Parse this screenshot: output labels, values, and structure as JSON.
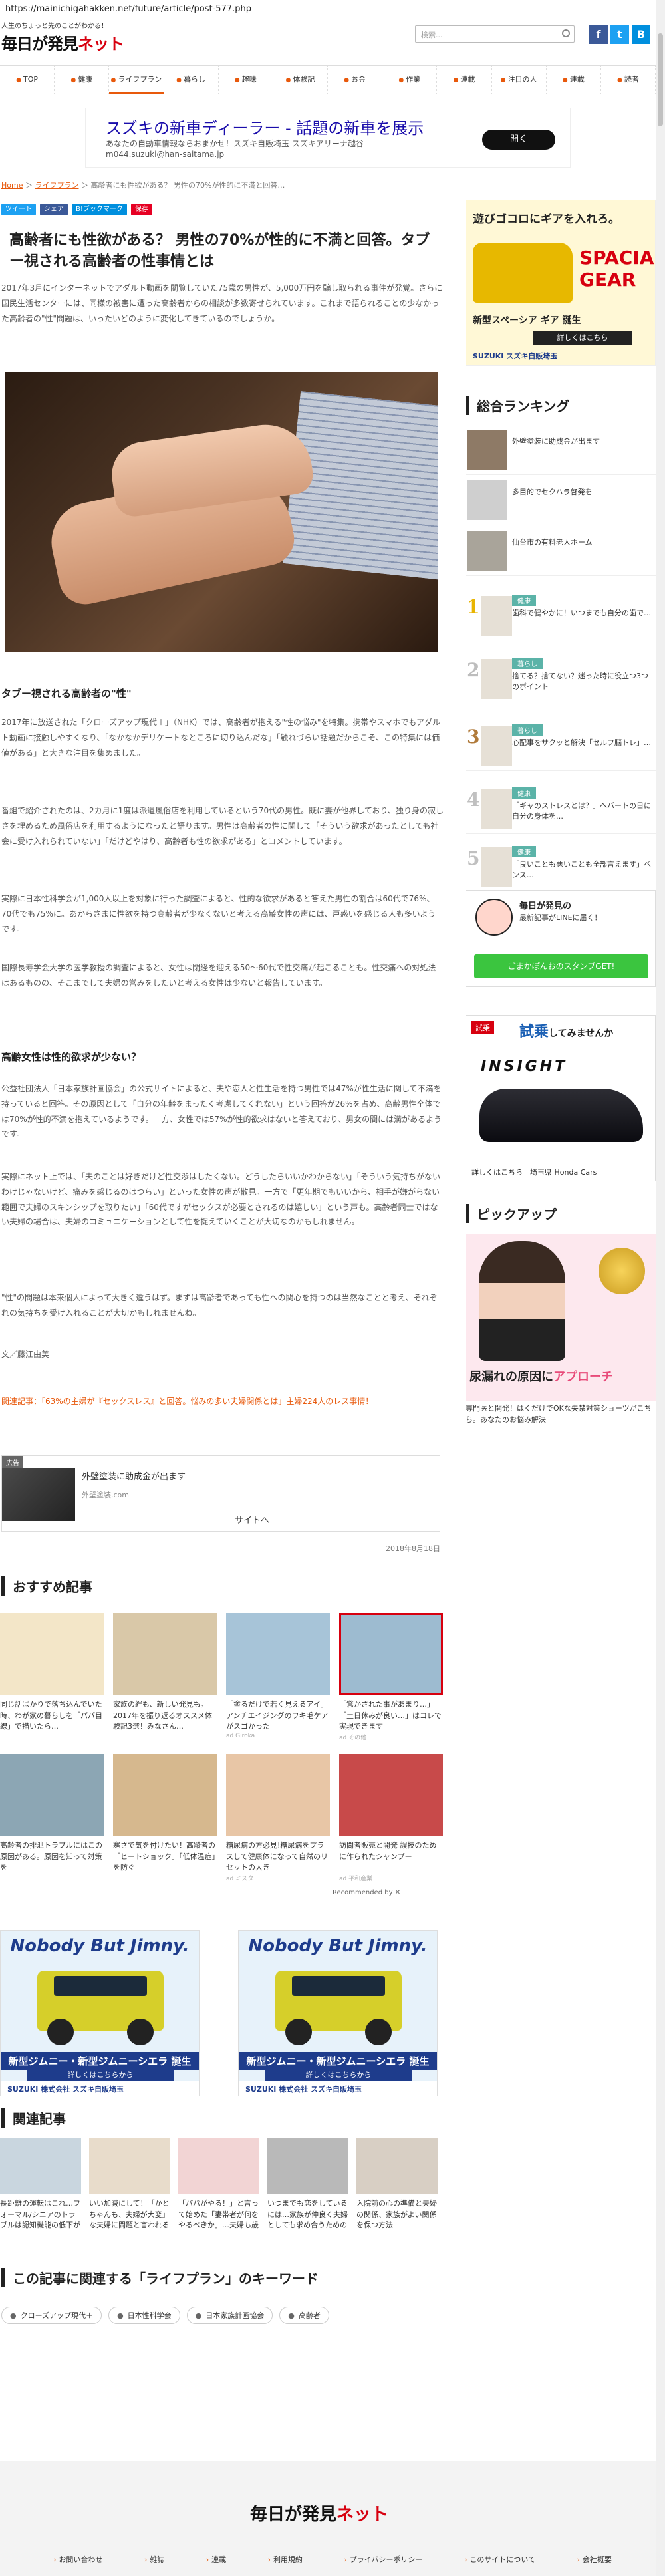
{
  "url": "https://mainichigahakken.net/future/article/post-577.php",
  "header": {
    "tagline": "人生のちょっと先のことがわかる！",
    "logo_main": "毎日が発見",
    "logo_net": "ネット",
    "search_placeholder": "検索...",
    "social": [
      "f",
      "t",
      "B"
    ]
  },
  "nav": [
    "TOP",
    "健康",
    "ライフプラン",
    "暮らし",
    "趣味",
    "体験記",
    "お金",
    "作業",
    "連載",
    "注目の人",
    "連載",
    "読者"
  ],
  "nav_active_index": 2,
  "ad_top": {
    "title": "スズキの新車ディーラー - 話題の新車を展示",
    "desc1": "あなたの自動車情報ならおまかせ！スズキ自販埼玉 スズキアリーナ越谷",
    "desc2": "m044.suzuki@han-saitama.jp",
    "button": "開く"
  },
  "breadcrumb": {
    "home": "Home",
    "sep1": "＞",
    "cat": "ライフプラン",
    "sep2": "＞",
    "current": "高齢者にも性欲がある？ 男性の70%が性的に不満と回答…"
  },
  "share": [
    {
      "label": "ツイート",
      "color": "#1da1f2"
    },
    {
      "label": "シェア",
      "color": "#3b5998"
    },
    {
      "label": "B!ブックマーク",
      "color": "#008fde"
    },
    {
      "label": "保存",
      "color": "#e60023"
    }
  ],
  "article": {
    "title": "高齢者にも性欲がある？ 男性の70%が性的に不満と回答。タブー視される高齢者の性事情とは",
    "lead": "2017年3月にインターネットでアダルト動画を閲覧していた75歳の男性が、5,000万円を騙し取られる事件が発覚。さらに国民生活センターには、同様の被害に遭った高齢者からの相談が多数寄せられています。これまで語られることの少なかった高齢者の\"性\"問題は、いったいどのように変化してきているのでしょうか。",
    "h1": "タブー視される高齢者の\"性\"",
    "p1": "2017年に放送された「クローズアップ現代＋」（NHK）では、高齢者が抱える\"性の悩み\"を特集。携帯やスマホでもアダルト動画に接触しやすくなり、「なかなかデリケートなところに切り込んだな」「触れづらい話題だからこそ、この特集には価値がある」と大きな注目を集めました。",
    "p2": "番組で紹介されたのは、2カ月に1度は派遣風俗店を利用しているという70代の男性。既に妻が他界しており、独り身の寂しさを埋めるため風俗店を利用するようになったと語ります。男性は高齢者の性に関して「そういう欲求があったとしても社会に受け入れられていない」「だけどやはり、高齢者も性の欲求がある」とコメントしています。",
    "p3": "実際に日本性科学会が1,000人以上を対象に行った調査によると、性的な欲求があると答えた男性の割合は60代で76%、70代でも75%に。あからさまに性欲を持つ高齢者が少なくないと考える高齢女性の声には、戸惑いを感じる人も多いようです。",
    "p4": "国際長寿学会大学の医学教授の調査によると、女性は閉経を迎える50〜60代で性交痛が起こることも。性交痛への対処法はあるものの、そこまでして夫婦の営みをしたいと考える女性は少ないと報告しています。",
    "h2": "高齢女性は性的欲求が少ない？",
    "p5": "公益社団法人「日本家族計画協会」の公式サイトによると、夫や恋人と性生活を持つ男性では47%が性生活に関して不満を持っていると回答。その原因として「自分の年齢をまったく考慮してくれない」という回答が26%を占め、高齢男性全体では70%が性的不満を抱えているようです。一方、女性では57%が性的欲求はないと答えており、男女の間には溝があるようです。",
    "p6": "実際にネット上では、「夫のことは好きだけど性交渉はしたくない。どうしたらいいかわからない」「そういう気持ちがないわけじゃないけど、痛みを感じるのはつらい」といった女性の声が散見。一方で「更年期でもいいから、相手が嫌がらない範囲で夫婦のスキンシップを取りたい」「60代ですがセックスが必要とされるのは嬉しい」という声も。高齢者同士ではない夫婦の場合は、夫婦のコミュニケーションとして性を捉えていくことが大切なのかもしれません。",
    "p7": "\"性\"の問題は本来個人によって大きく違うはず。まずは高齢者であっても性への関心を持つのは当然なことと考え、それぞれの気持ちを受け入れることが大切かもしれませんね。",
    "author": "文／藤江由美",
    "related_link": "関連記事：「63%の主婦が『セックスレス』と回答。悩みの多い夫婦関係とは」主婦224人のレス事情！"
  },
  "ad_small": {
    "label": "広告",
    "title": "外壁塗装に助成金が出ます",
    "domain": "外壁塗装.com",
    "visit": "サイトへ"
  },
  "date": "2018年8月18日",
  "recommend": {
    "heading": "おすすめ記事",
    "by": "Recommended by",
    "items": [
      {
        "text": "同じ話ばかりで落ち込んでいた時、わが家の暮らしを「パパ目線」で描いたら…",
        "src": ""
      },
      {
        "text": "家族の絆も、新しい発見も。2017年を振り返るオススメ体験記3選！みなさん…",
        "src": ""
      },
      {
        "text": "「塗るだけで若く見えるアイ」アンチエイジングのワキ毛ケアがスゴかった",
        "src": "ad Giroka"
      },
      {
        "text": "「驚かされた事があまり…」「土日休みが良い…」はコレで実現できます",
        "src": "ad その他"
      },
      {
        "text": "高齢者の排泄トラブルにはこの原因がある。原因を知って対策を",
        "src": ""
      },
      {
        "text": "寒さで気を付けたい！高齢者の「ヒートショック」「低体温症」を防ぐ",
        "src": ""
      },
      {
        "text": "糖尿病の方必見!糖尿病をプラスして健康体になって自然のリセットの大き",
        "src": "ad ミスタ"
      },
      {
        "text": "訪問者販売と開発 誤技のために作られたシャンプー",
        "src": "ad 平和産業"
      }
    ]
  },
  "jimny": {
    "title": "Nobody But Jimny.",
    "sub": "新型ジムニー・新型ジムニーシエラ 誕生",
    "btn": "詳しくはこちらから",
    "foot": "SUZUKI 株式会社 スズキ自販埼玉"
  },
  "related": {
    "heading": "関連記事",
    "items": [
      "長距離の運転はこれ…フォーマル/シニアのトラブルは認知機能の低下が原因？",
      "いい加減にして！「かとちゃんも、夫婦が大変」な夫婦に問題と言われる家庭…",
      "「パパがやる！」と言って始めた「妻帯者が何をやるべきか」…夫婦も歳を重ねること",
      "いつまでも恋をしているには…家族が仲良く夫婦としても求め合うための秘訣",
      "入院前の心の準備と夫婦の関係、家族がよい関係を保つ方法"
    ]
  },
  "keywords": {
    "heading": "この記事に関連する「ライフプラン」のキーワード",
    "items": [
      "クローズアップ現代＋",
      "日本性科学会",
      "日本家族計画協会",
      "高齢者"
    ]
  },
  "sidebar": {
    "ad1": {
      "title": "遊びゴコロにギアを入れろ。",
      "sub": "SPACIA GEAR",
      "tag": "新型スペーシア ギア 誕生",
      "btn": "詳しくはこちら",
      "foot": "SUZUKI スズキ自販埼玉"
    },
    "ranking_heading": "総合ランキング",
    "ranking": [
      {
        "cat": "",
        "title": "外壁塗装に助成金が出ます"
      },
      {
        "cat": "",
        "title": "多目的でセクハラ啓発を"
      },
      {
        "cat": "",
        "title": "仙台市の有料老人ホーム"
      },
      {
        "cat": "健康",
        "title": "歯科で健やかに！いつまでも自分の歯で…"
      },
      {
        "cat": "暮らし",
        "title": "捨てる？捨てない？迷った時に役立つ3つのポイント"
      },
      {
        "cat": "暮らし",
        "title": "心配事をサクッと解決「セルフ脳トレ」…"
      },
      {
        "cat": "健康",
        "title": "「ギャのストレスとは？」ヘバートの日に自分の身体を…"
      },
      {
        "cat": "健康",
        "title": "「良いことも悪いことも全部言えます」ペンス…"
      }
    ],
    "line": {
      "t1": "毎日が発見の",
      "t2": "最新記事がLINEに届く！",
      "btn": "ごまかぽんおのスタンプGET!"
    },
    "insight": {
      "tag": "試乗",
      "title": "試乗",
      "suffix": "してみませんか",
      "name": "INSIGHT",
      "foot": "詳しくはこちら　埼玉県 Honda Cars"
    },
    "pickup_heading": "ピックアップ",
    "pickup_title": "尿漏れの原因に",
    "pickup_red": "アプローチ",
    "pickup_caption": "専門医と開発！はくだけでOKな失禁対策ショーツがこちら。あなたのお悩み解決"
  },
  "footer": {
    "logo": "毎日が発見",
    "logo_net": "ネット",
    "links": [
      "お問い合わせ",
      "雑誌",
      "連載",
      "利用規約",
      "プライバシーポリシー",
      "このサイトについて",
      "会社概要"
    ]
  },
  "colors": {
    "accent": "#e8590c",
    "brand": "#d7000f",
    "line": "#3bc53f"
  }
}
